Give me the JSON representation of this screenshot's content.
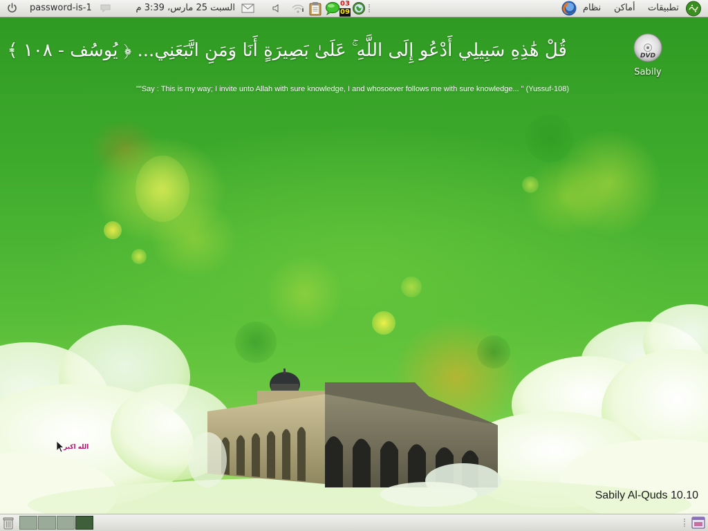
{
  "top_panel": {
    "logo_icon": "sabily-logo-icon",
    "menus": [
      "تطبيقات",
      "أماكن",
      "نظام"
    ],
    "browser_icon": "firefox-icon",
    "clock": "السبت 25 مارس، 3:39 م",
    "user": "password-is-1",
    "indicator": {
      "top": "03",
      "bottom": "09"
    },
    "icons": [
      "power-icon",
      "chat-status-icon",
      "mail-icon",
      "volume-icon",
      "network-icon",
      "clipboard-icon",
      "chat-bubble-icon",
      "update-globe-icon"
    ]
  },
  "desktop": {
    "verse_arabic": "قُلْ هَٰذِهِ سَبِيلِي أَدْعُو إِلَى اللَّهِ ۚ عَلَىٰ بَصِيرَةٍ أَنَا وَمَنِ اتَّبَعَنِي... ﴿ يُوسُف - ١٠٨ ﴾",
    "verse_english": "\"\"Say : This is my way; I invite unto Allah with sure knowledge, I and whosoever follows me with sure knowledge... \" (Yussuf-108)",
    "icons": [
      {
        "label": "Sabily",
        "icon": "dvd-icon"
      }
    ],
    "takbir": "الله اكبر",
    "version": "Sabily Al-Quds 10.10",
    "colors": {
      "accent_green": "#3fab2d",
      "highlight_yellow": "#e6f050",
      "takbir_magenta": "#b0126e"
    }
  },
  "bottom_panel": {
    "trash_icon": "trash-icon",
    "workspaces": 4,
    "active_workspace": 4,
    "show_desktop_icon": "show-desktop-icon"
  }
}
